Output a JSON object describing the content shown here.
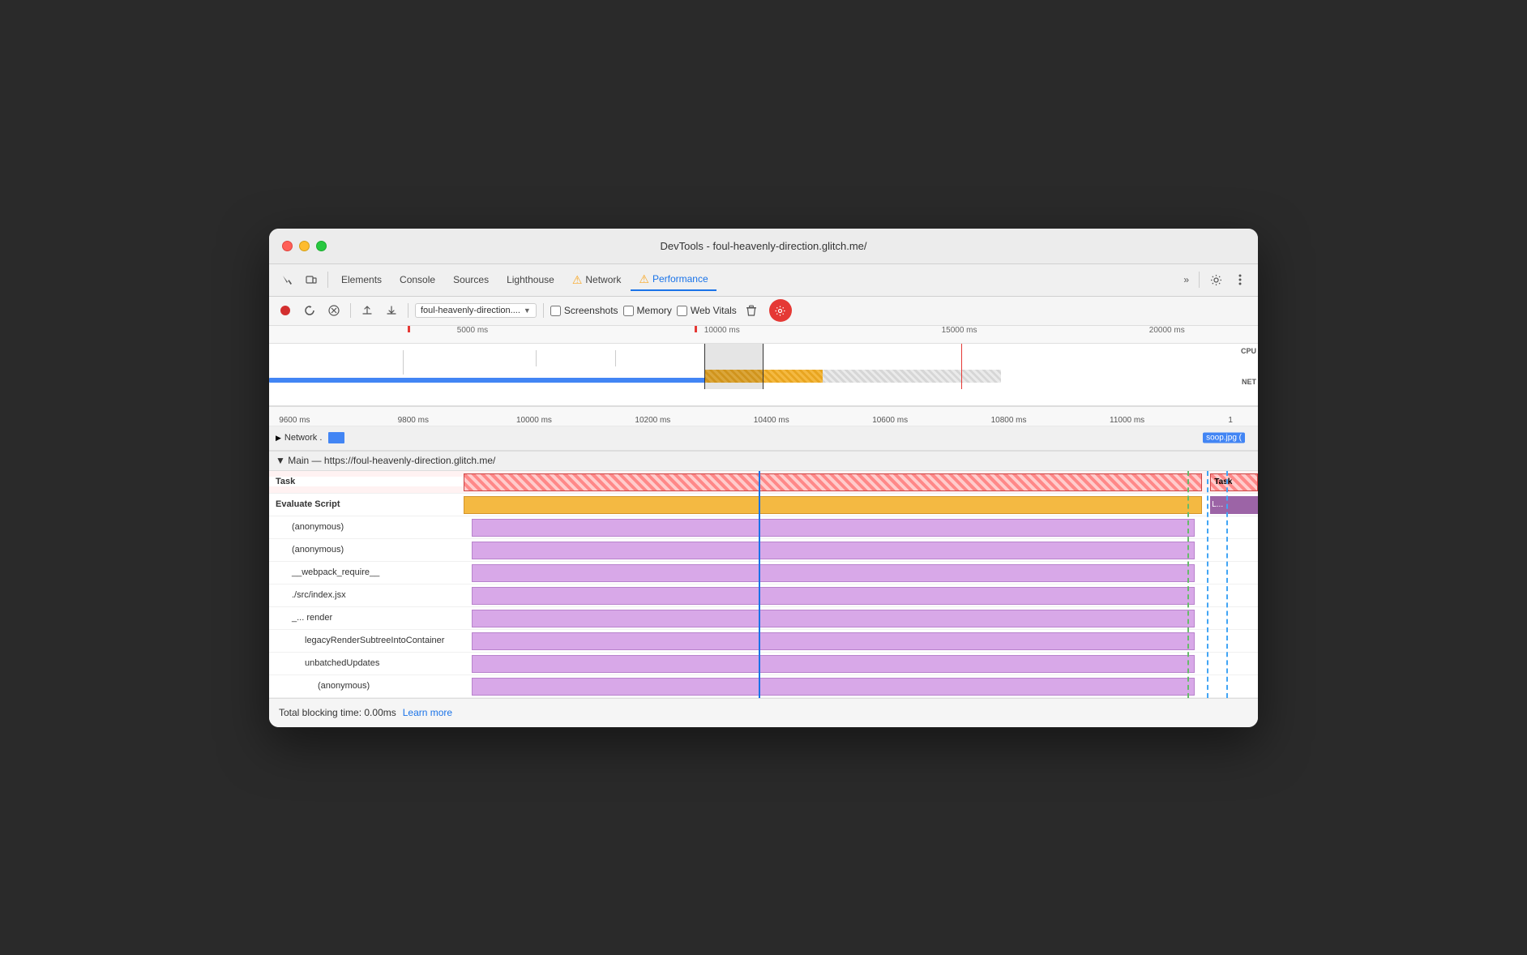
{
  "window": {
    "title": "DevTools - foul-heavenly-direction.glitch.me/"
  },
  "titlebar": {
    "title": "DevTools - foul-heavenly-direction.glitch.me/"
  },
  "toolbar": {
    "tabs": [
      {
        "label": "Elements",
        "active": false
      },
      {
        "label": "Console",
        "active": false
      },
      {
        "label": "Sources",
        "active": false
      },
      {
        "label": "Lighthouse",
        "active": false
      },
      {
        "label": "Network",
        "active": false,
        "warn": true
      },
      {
        "label": "Performance",
        "active": true,
        "warn": true
      }
    ],
    "more_label": "»",
    "settings_tooltip": "Settings"
  },
  "controls": {
    "url": "foul-heavenly-direction....",
    "screenshots_label": "Screenshots",
    "memory_label": "Memory",
    "web_vitals_label": "Web Vitals"
  },
  "timeline": {
    "ruler_marks": [
      "5000 ms",
      "10000 ms",
      "15000 ms",
      "20000 ms"
    ],
    "cpu_label": "CPU",
    "net_label": "NET"
  },
  "time_ruler": {
    "marks": [
      "9600 ms",
      "9800 ms",
      "10000 ms",
      "10200 ms",
      "10400 ms",
      "10600 ms",
      "10800 ms",
      "11000 ms",
      "1"
    ]
  },
  "network_row": {
    "label": "Network .",
    "right_label": "soop.jpg ("
  },
  "main": {
    "header": "▼ Main — https://foul-heavenly-direction.glitch.me/",
    "rows": [
      {
        "label": "Task",
        "type": "task",
        "indent": 0,
        "right_label": "Task"
      },
      {
        "label": "Evaluate Script",
        "type": "evaluate",
        "indent": 0,
        "right_label": "L..."
      },
      {
        "label": "(anonymous)",
        "type": "purple",
        "indent": 1
      },
      {
        "label": "(anonymous)",
        "type": "purple",
        "indent": 1
      },
      {
        "label": "__webpack_require__",
        "type": "purple",
        "indent": 1
      },
      {
        "label": "./src/index.jsx",
        "type": "purple",
        "indent": 1
      },
      {
        "label": "_...  render",
        "type": "purple",
        "indent": 1
      },
      {
        "label": "legacyRenderSubtreeIntoContainer",
        "type": "purple",
        "indent": 2
      },
      {
        "label": "unbatchedUpdates",
        "type": "purple",
        "indent": 2
      },
      {
        "label": "(anonymous)",
        "type": "purple",
        "indent": 2
      }
    ]
  },
  "status_bar": {
    "total_blocking_time": "Total blocking time: 0.00ms",
    "learn_more_label": "Learn more"
  }
}
